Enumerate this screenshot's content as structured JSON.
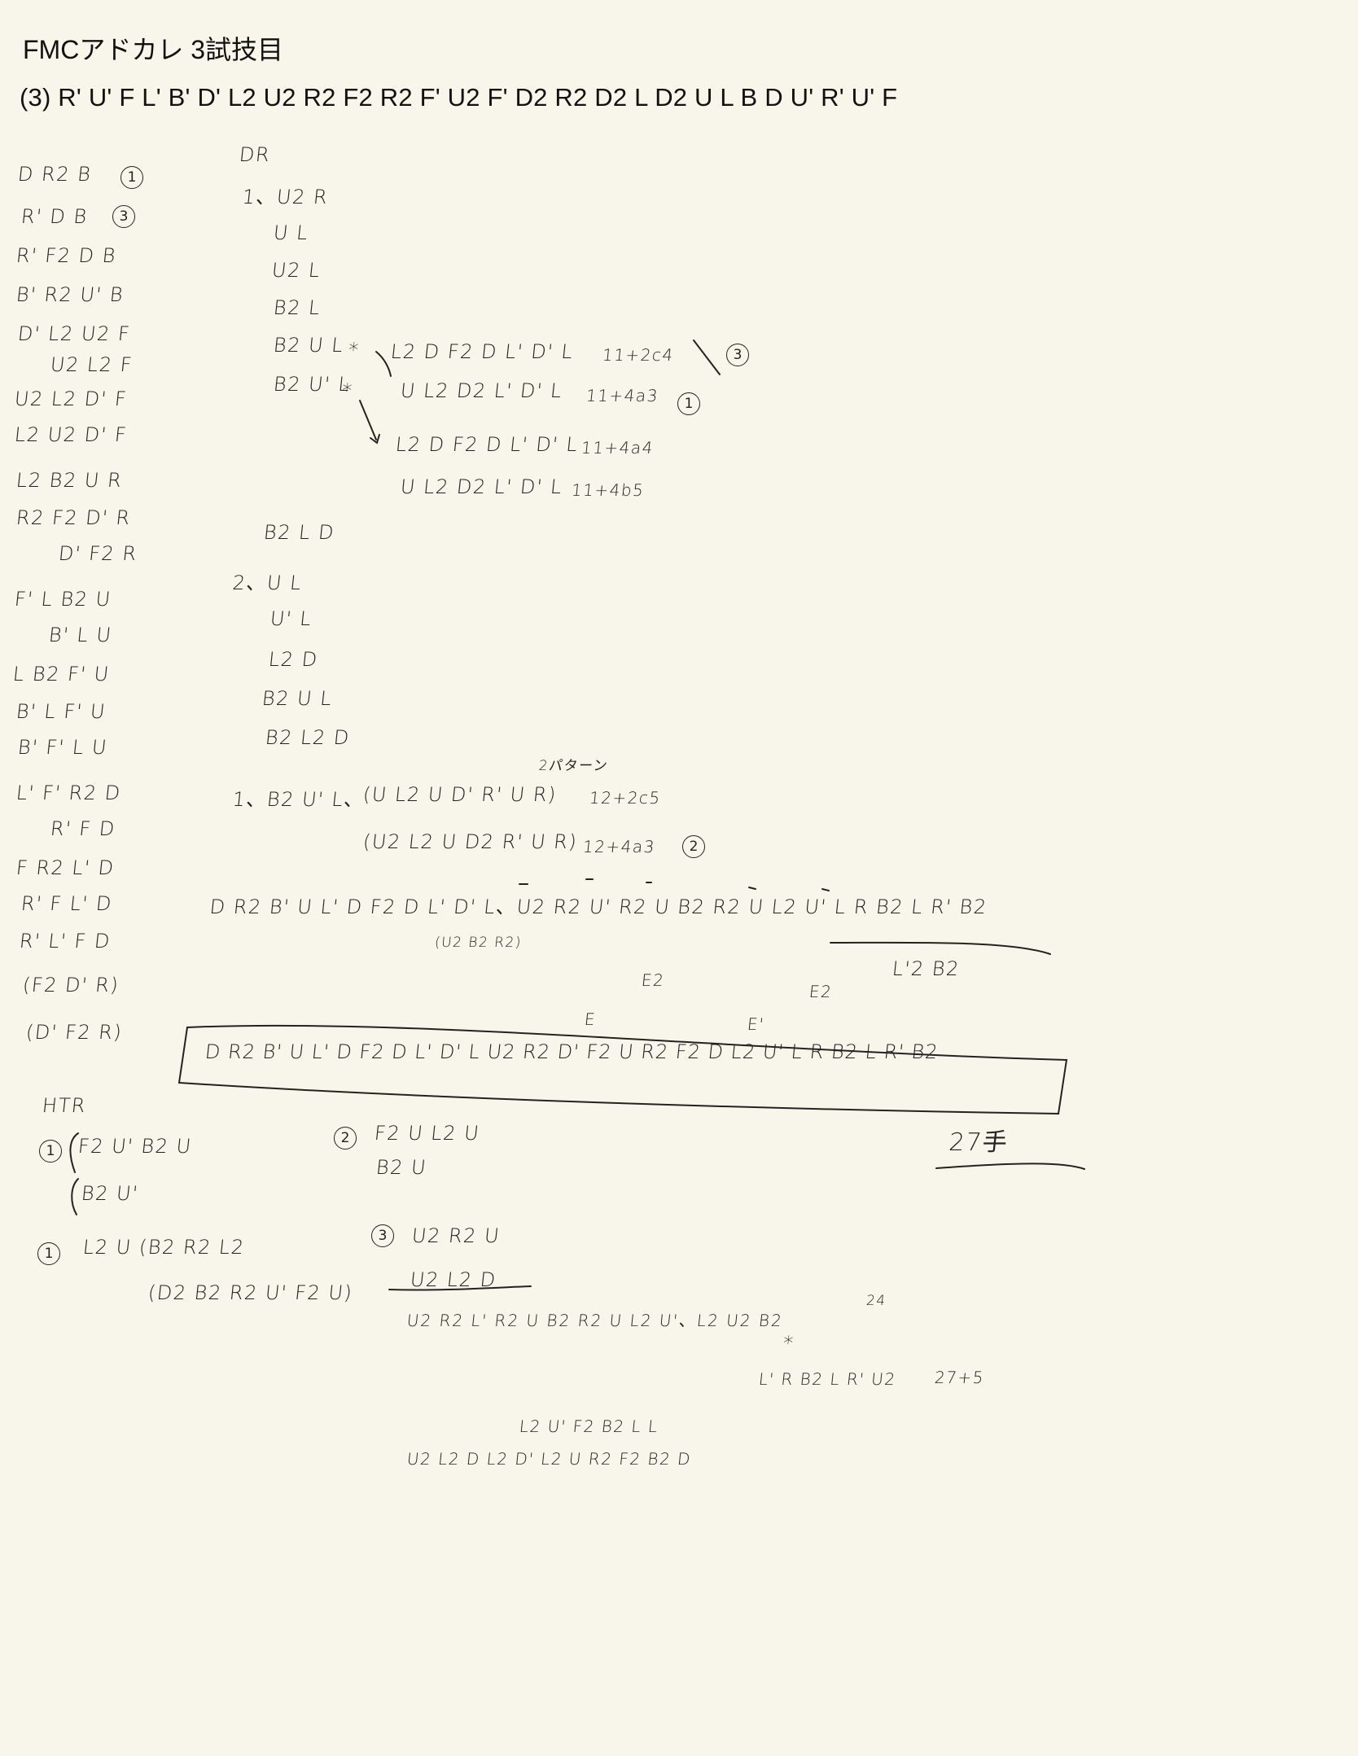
{
  "title": "FMCアドカレ 3試技目",
  "scramble": "(3) R' U' F L' B' D' L2 U2 R2 F2 R2 F' U2 F' D2 R2 D2 L D2 U L B D U' R' U' F",
  "left_column": [
    "D R2 B",
    "R' D B",
    "R' F2 D B",
    "B' R2 U' B",
    "D' L2 U2 F",
    "U2 L2 F",
    "U2 L2 D' F",
    "L2 U2 D' F",
    "L2 B2 U R",
    "R2 F2 D' R",
    "D' F2 R",
    "F' L B2 U",
    "B' L U",
    "L B2 F' U",
    "B' L F' U",
    "B' F' L U",
    "L' F' R2 D",
    "R' F D",
    "F R2 L' D",
    "R' F L' D",
    "R' L' F D",
    "(F2 D' R)",
    "(D' F2 R)"
  ],
  "left_marks": [
    "1",
    "3"
  ],
  "dr_header": "DR",
  "section1": {
    "label": "1、U2 R",
    "items": [
      "U L",
      "U2 L",
      "B2 L",
      "B2 U L",
      "B2 U' L"
    ],
    "branches": [
      {
        "moves": "L2 D F2 D L' D' L",
        "count": "11+2c4",
        "mark": "3"
      },
      {
        "moves": "U L2 D2 L' D' L",
        "count": "11+4a3",
        "mark": "1"
      },
      {
        "moves": "L2 D F2 D L' D' L",
        "count": "11+4a4"
      },
      {
        "moves": "U L2 D2 L' D' L",
        "count": "11+4b5"
      }
    ],
    "b2ld": "B2 L D"
  },
  "section2": {
    "label": "2、U L",
    "items": [
      "U' L",
      "L2 D",
      "B2 U L",
      "B2 L2 D"
    ]
  },
  "pattern_note": "2パターン",
  "line_a": {
    "prefix": "1、B2 U' L、",
    "moves": "(U L2 U D' R' U R)",
    "count": "12+2c5"
  },
  "line_b": {
    "moves": "(U2 L2 U D2 R' U R)",
    "count": "12+4a3",
    "mark": "2"
  },
  "long_line": "D R2 B' U L' D F2 D L' D' L、U2 R2 U' R2 U B2 R2 U L2 U' L R B2 L R' B2",
  "long_line_sub": "(U2 B2 R2)",
  "under_line": "L'2 B2",
  "e2_a": "E2",
  "e2_b": "E2",
  "e_a": "E",
  "e_b": "E'",
  "boxed_solution": "D R2 B' U L' D F2 D L' D' L  U2 R2 D' F2 U R2 F2 D L2 U' L R B2 L R' B2",
  "move_count": "27手",
  "htr": {
    "label": "HTR",
    "m1a": "F2 U' B2 U",
    "m1b": "B2 U'",
    "m1c": "L2 U (B2 R2 L2",
    "m1d": "(D2 B2 R2 U' F2 U)",
    "m2a": "F2 U L2 U",
    "m2b": "B2 U",
    "m3a": "U2 R2 U",
    "m3b": "U2 L2 D",
    "line1": "U2 R2 L' R2 U B2 R2 U L2 U'、L2 U2 B2",
    "line1_num": "24",
    "star": "*",
    "line2": "L' R B2 L R' U2",
    "line2_count": "27+5",
    "line3": "L2 U' F2 B2 L L",
    "line4": "U2 L2 D L2 D' L2 U R2 F2 B2 D"
  }
}
